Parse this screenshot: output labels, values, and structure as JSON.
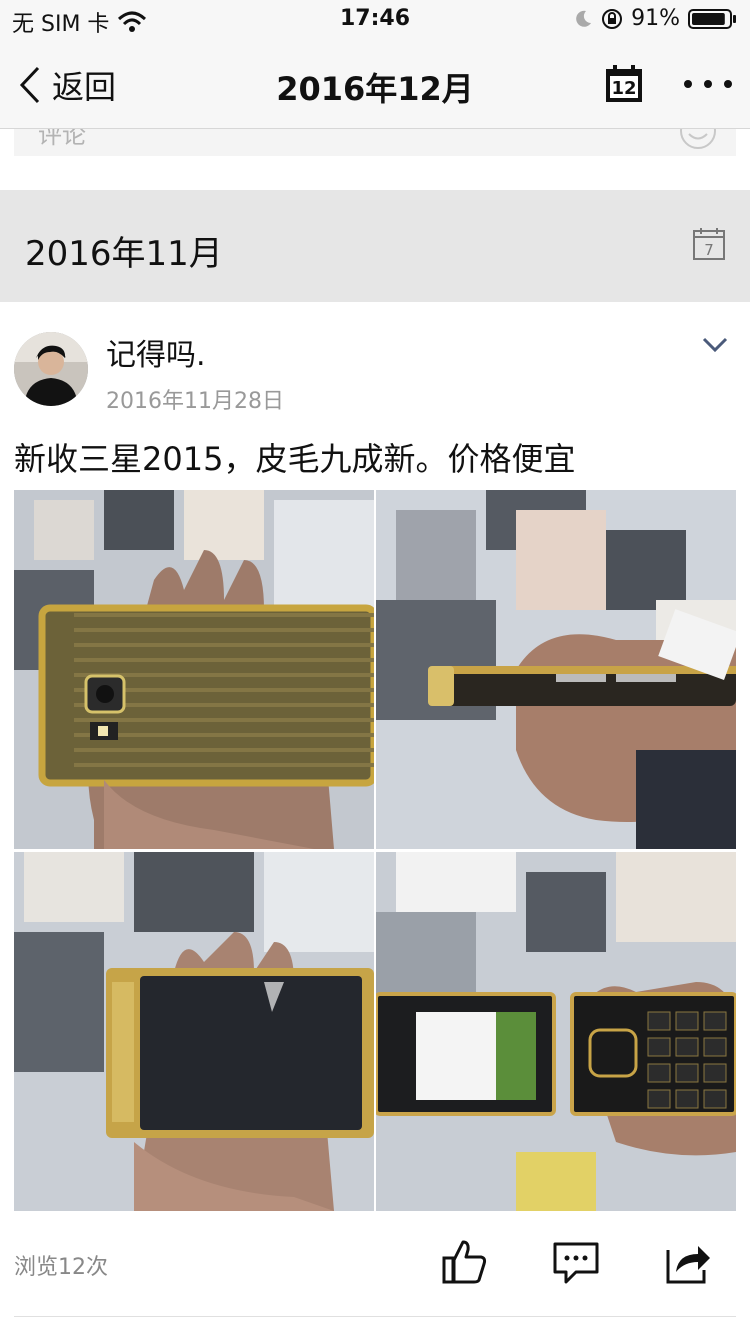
{
  "status_bar": {
    "carrier": "无 SIM 卡",
    "time": "17:46",
    "battery": "91%",
    "battery_level": 0.91
  },
  "nav": {
    "back_label": "返回",
    "title": "2016年12月",
    "calendar_day": "12"
  },
  "prev_post": {
    "comment_text": "评论"
  },
  "month_section": {
    "title": "2016年11月",
    "calendar_day": "7"
  },
  "post": {
    "author": "记得吗.",
    "date": "2016年11月28日",
    "text": "新收三星2015，皮毛九成新。价格便宜",
    "photos": [
      {
        "name": "phone-back"
      },
      {
        "name": "phone-side"
      },
      {
        "name": "phone-front"
      },
      {
        "name": "phone-open"
      }
    ],
    "views": "浏览12次"
  },
  "icons": {
    "like": "thumbs-up-icon",
    "comment": "comment-icon",
    "share": "share-icon"
  }
}
